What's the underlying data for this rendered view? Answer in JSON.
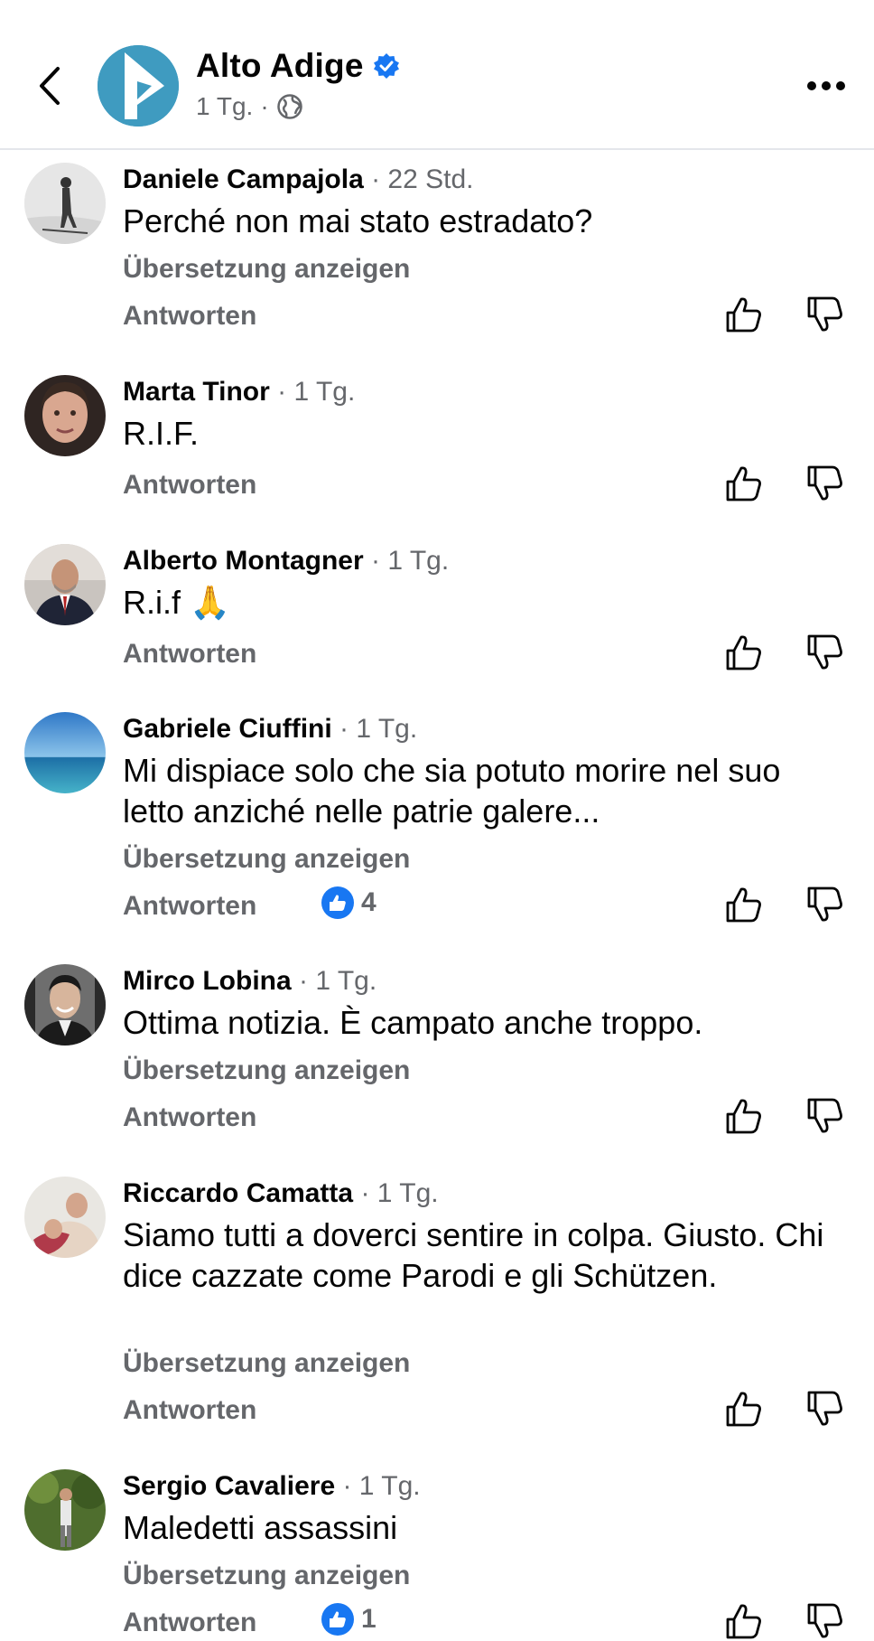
{
  "header": {
    "title": "Alto Adige",
    "meta_time": "1 Tg.",
    "meta_separator": "·"
  },
  "comments": [
    {
      "name": "Daniele Campajola",
      "time": "· 22 Std.",
      "text": "Perché non mai stato estradato?",
      "translate": "Übersetzung anzeigen",
      "reply": "Antworten"
    },
    {
      "name": "Marta Tinor",
      "time": "· 1 Tg.",
      "text": "R.I.F.",
      "reply": "Antworten"
    },
    {
      "name": "Alberto Montagner",
      "time": "· 1 Tg.",
      "text": "R.i.f 🙏",
      "reply": "Antworten"
    },
    {
      "name": "Gabriele Ciuffini",
      "time": "· 1 Tg.",
      "text": "Mi dispiace solo che sia potuto morire nel suo letto anziché nelle patrie galere...",
      "translate": "Übersetzung anzeigen",
      "reply": "Antworten",
      "reactions": "4"
    },
    {
      "name": "Mirco Lobina",
      "time": "· 1 Tg.",
      "text": "Ottima notizia. È campato anche troppo.",
      "translate": "Übersetzung anzeigen",
      "reply": "Antworten"
    },
    {
      "name": "Riccardo Camatta",
      "time": "· 1 Tg.",
      "text": "Siamo tutti a doverci sentire in colpa. Giusto. Chi dice cazzate come Parodi e gli Schützen.",
      "translate": "Übersetzung anzeigen",
      "reply": "Antworten"
    },
    {
      "name": "Sergio Cavaliere",
      "time": "· 1 Tg.",
      "text": "Maledetti assassini",
      "translate": "Übersetzung anzeigen",
      "reply": "Antworten",
      "reactions": "1"
    }
  ],
  "colors": {
    "accent": "#1877f2",
    "secondary_text": "#65676b",
    "primary_text": "#050505",
    "page_logo": "#3f9bc0"
  },
  "icons": [
    "back-arrow-icon",
    "verified-badge-icon",
    "globe-icon",
    "more-options-icon",
    "thumbs-up-icon",
    "thumbs-down-icon",
    "like-reaction-icon"
  ]
}
